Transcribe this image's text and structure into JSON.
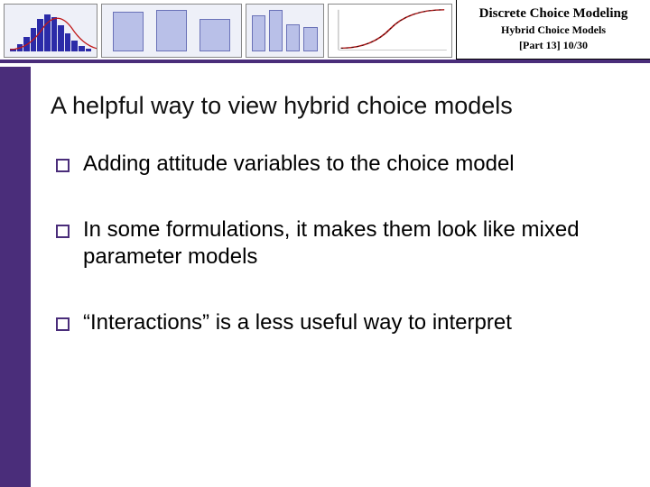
{
  "header": {
    "course_title": "Discrete Choice Modeling",
    "subtitle": "Hybrid Choice Models",
    "part_line": "[Part  13]   10/30"
  },
  "slide": {
    "title": "A helpful way to view hybrid choice models",
    "bullets": [
      "Adding attitude variables to the choice model",
      "In some formulations, it makes them look like mixed parameter models",
      "“Interactions” is a less useful way to interpret"
    ]
  }
}
